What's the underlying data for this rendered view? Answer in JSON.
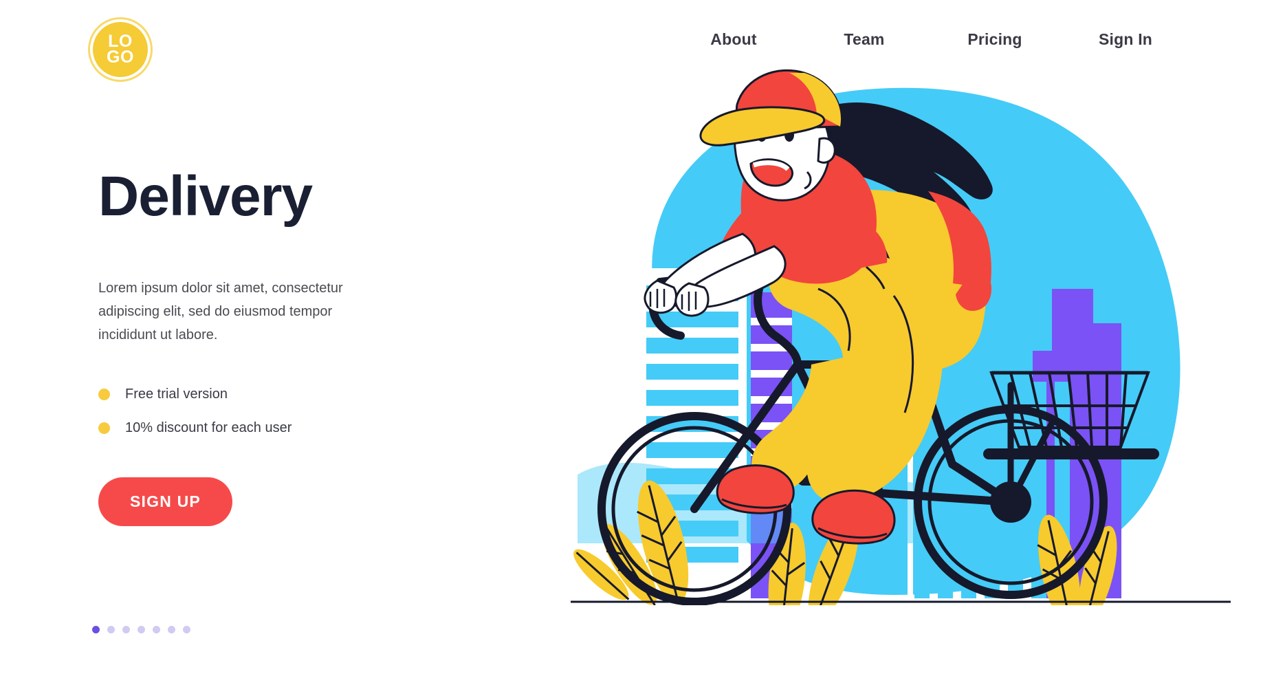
{
  "header": {
    "logo": {
      "line1": "LO",
      "line2": "GO",
      "name": "logo"
    },
    "nav": [
      {
        "label": "About"
      },
      {
        "label": "Team"
      },
      {
        "label": "Pricing"
      },
      {
        "label": "Sign In"
      }
    ]
  },
  "hero": {
    "headline": "Delivery",
    "paragraph": "Lorem ipsum dolor sit amet, consectetur adipiscing elit, sed do eiusmod tempor incididunt ut labore.",
    "features": [
      {
        "label": "Free trial version"
      },
      {
        "label": "10% discount for each user"
      }
    ],
    "cta_label": "SIGN UP",
    "carousel": {
      "total": 7,
      "active_index": 1
    }
  },
  "illustration": {
    "name": "delivery-courier-on-bicycle",
    "description": "Flat illustration of a smiling courier with cap, ponytail and yellow backpack riding a bicycle with a front basket in front of a city skyline"
  },
  "colors": {
    "brand_yellow": "#F5CB36",
    "accent_red": "#F64A4A",
    "accent_cyan": "#45CBF7",
    "accent_purple": "#7B52F5",
    "ink": "#1A1F33",
    "nav_text": "#3A3B45",
    "body_text": "#4A4A52",
    "dot_active": "#6C4FE0",
    "dot_inactive": "#CFCBF2"
  }
}
